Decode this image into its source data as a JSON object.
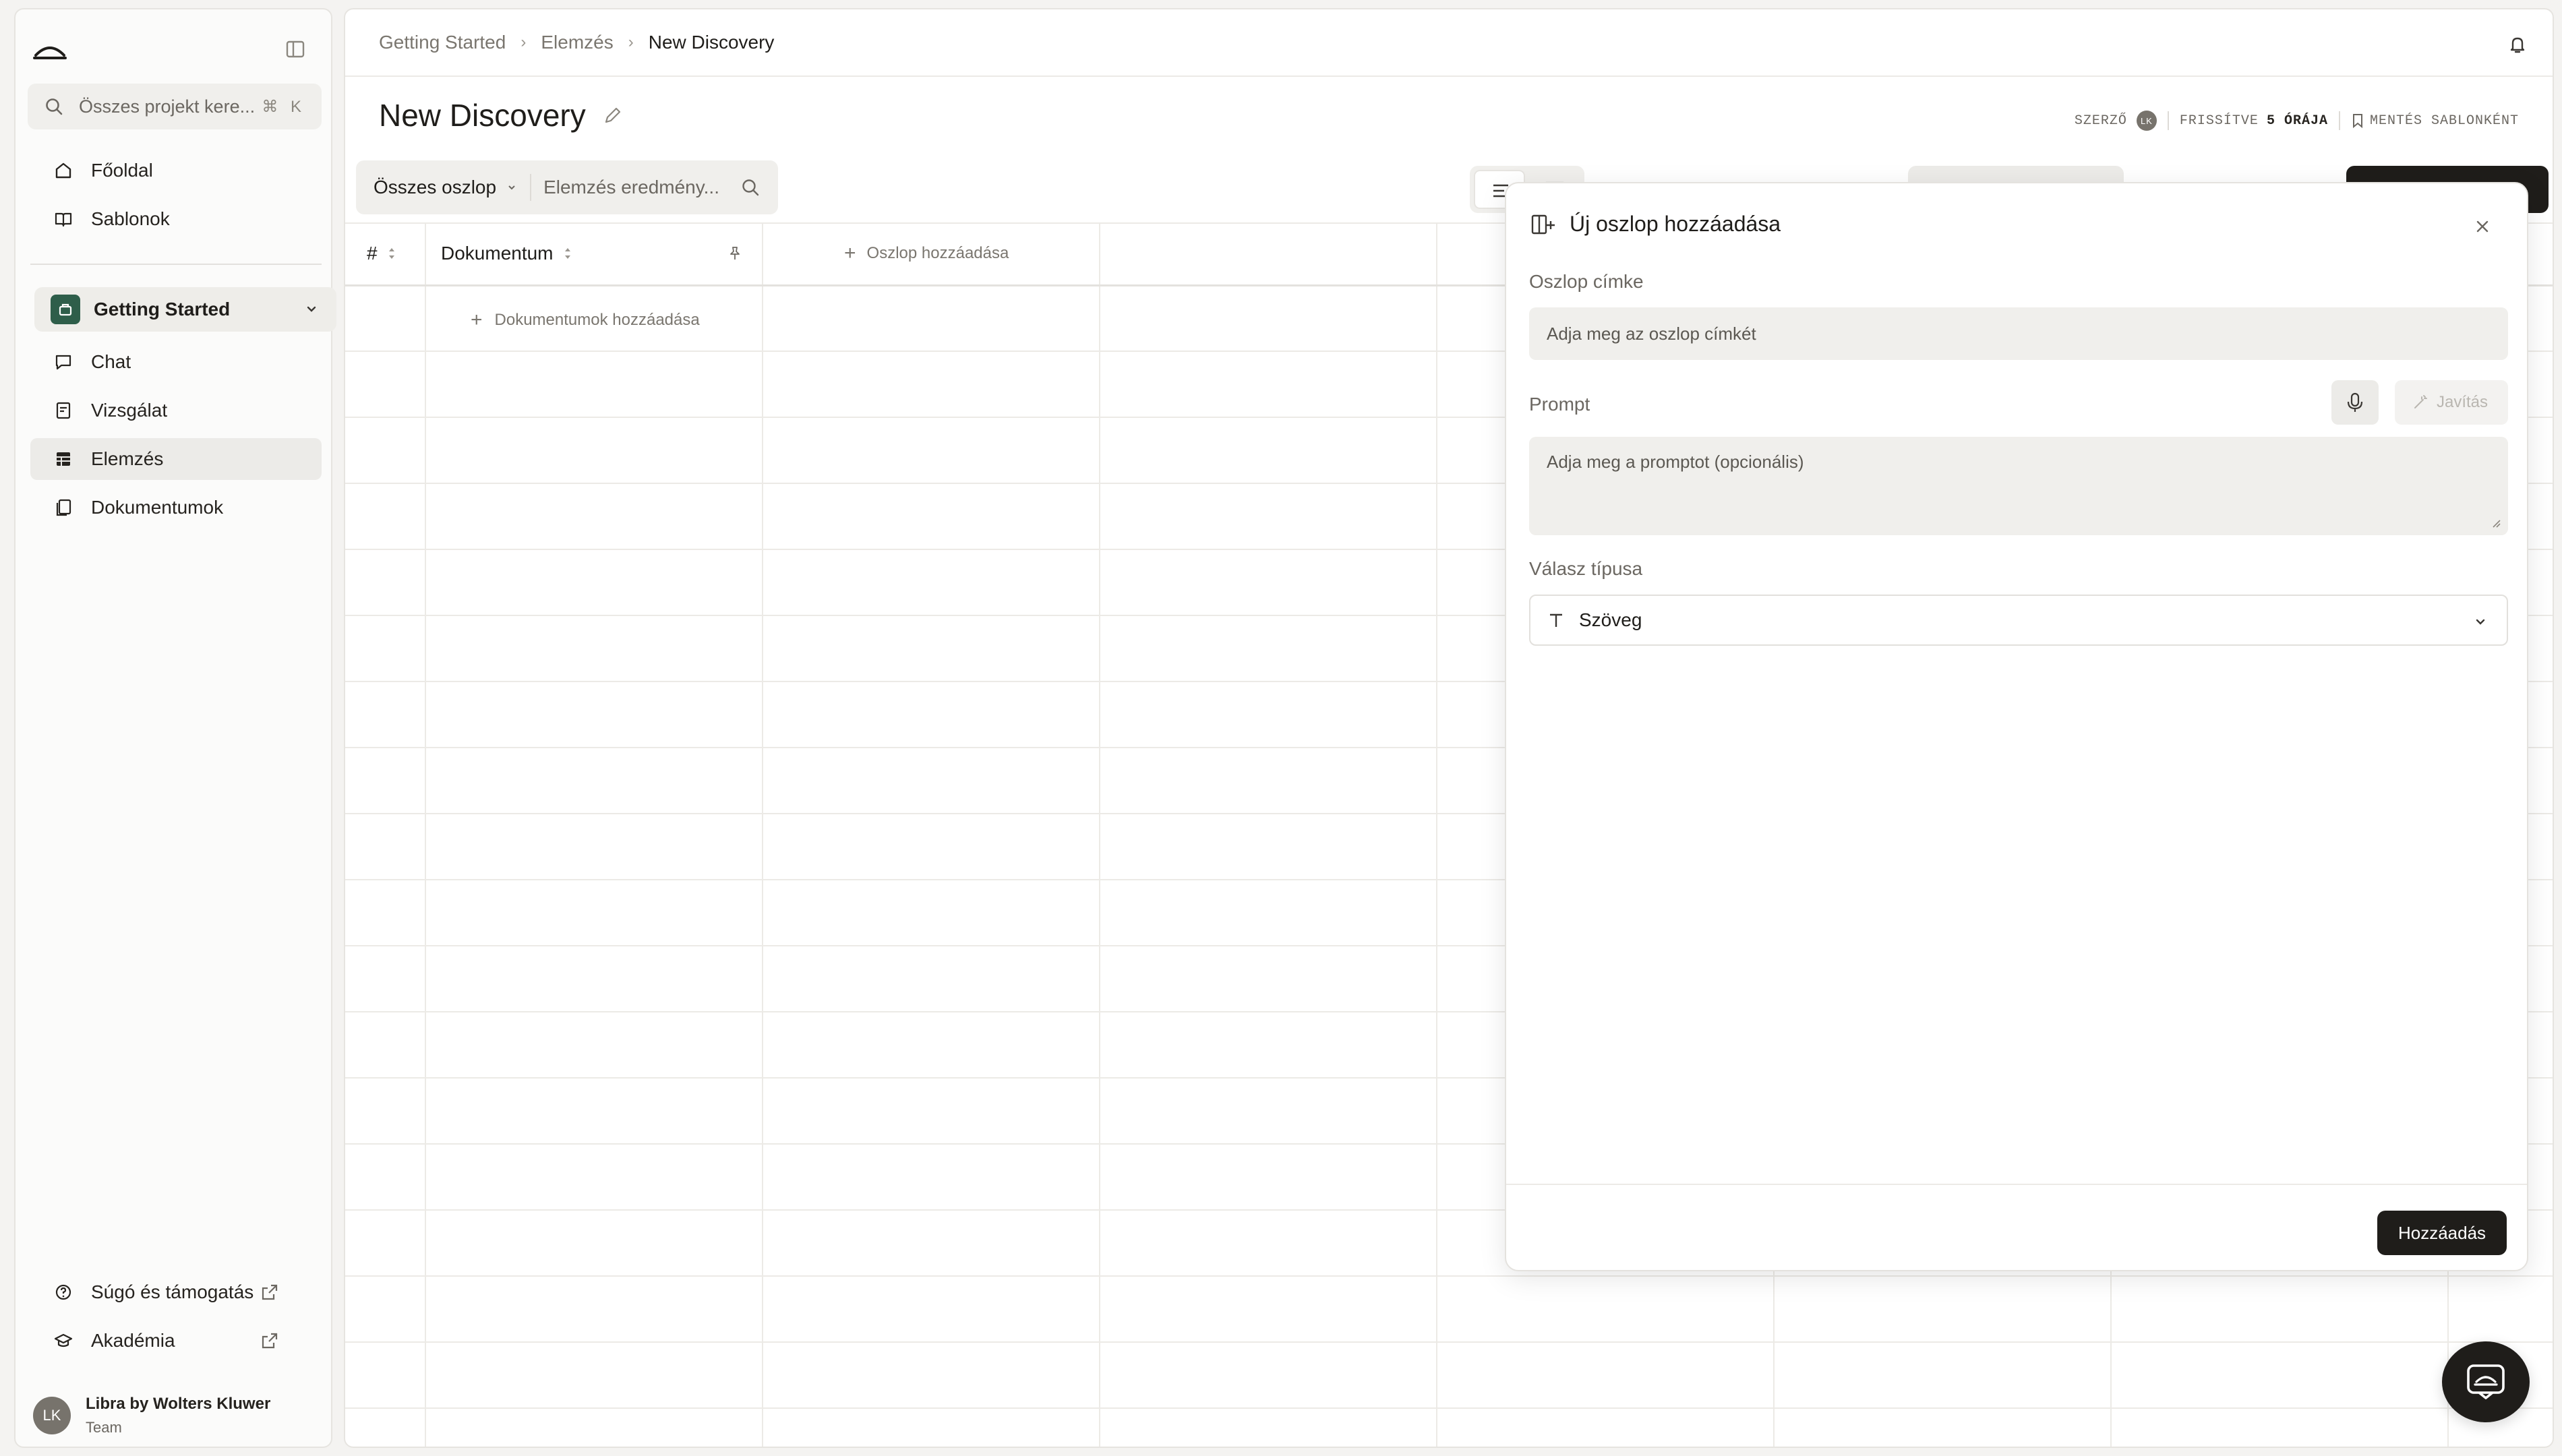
{
  "sidebar": {
    "search": {
      "placeholder": "Összes projekt kere...",
      "shortcut": "⌘ K"
    },
    "top_items": [
      {
        "label": "Főoldal",
        "icon": "home-icon"
      },
      {
        "label": "Sablonok",
        "icon": "book-icon"
      }
    ],
    "project": {
      "label": "Getting Started"
    },
    "project_items": [
      {
        "label": "Chat",
        "icon": "chat-icon"
      },
      {
        "label": "Vizsgálat",
        "icon": "review-icon"
      },
      {
        "label": "Elemzés",
        "icon": "table-icon",
        "active": true
      },
      {
        "label": "Dokumentumok",
        "icon": "documents-icon"
      }
    ],
    "bottom_items": [
      {
        "label": "Súgó és támogatás",
        "icon": "help-icon"
      },
      {
        "label": "Akadémia",
        "icon": "academy-icon"
      }
    ],
    "user": {
      "initials": "LK",
      "name": "Libra by Wolters Kluwer",
      "team": "Team"
    }
  },
  "breadcrumb": [
    "Getting Started",
    "Elemzés",
    "New Discovery"
  ],
  "page": {
    "title": "New Discovery",
    "meta": {
      "author_label": "SZERZŐ",
      "author_initials": "LK",
      "updated_label": "FRISSÍTVE",
      "updated_value": "5 ÓRÁJA",
      "save_template": "MENTÉS SABLONKÉNT"
    }
  },
  "toolbar": {
    "columns_select": "Összes oszlop",
    "results_search_placeholder": "Elemzés eredmény..."
  },
  "table": {
    "headers": {
      "index": "#",
      "document": "Dokumentum",
      "add_column": "Oszlop hozzáadása"
    },
    "add_documents": "Dokumentumok hozzáadása"
  },
  "dialog": {
    "title": "Új oszlop hozzáadása",
    "column_label": {
      "label": "Oszlop címke",
      "placeholder": "Adja meg az oszlop címkét"
    },
    "prompt": {
      "label": "Prompt",
      "placeholder": "Adja meg a promptot (opcionális)",
      "fix_button": "Javítás"
    },
    "response_type": {
      "label": "Válasz típusa",
      "value": "Szöveg"
    },
    "submit": "Hozzáadás"
  },
  "colors": {
    "brand_dark": "#1f1d1a",
    "project_green": "#2e5e4a",
    "accent_bg": "#f0efec"
  }
}
